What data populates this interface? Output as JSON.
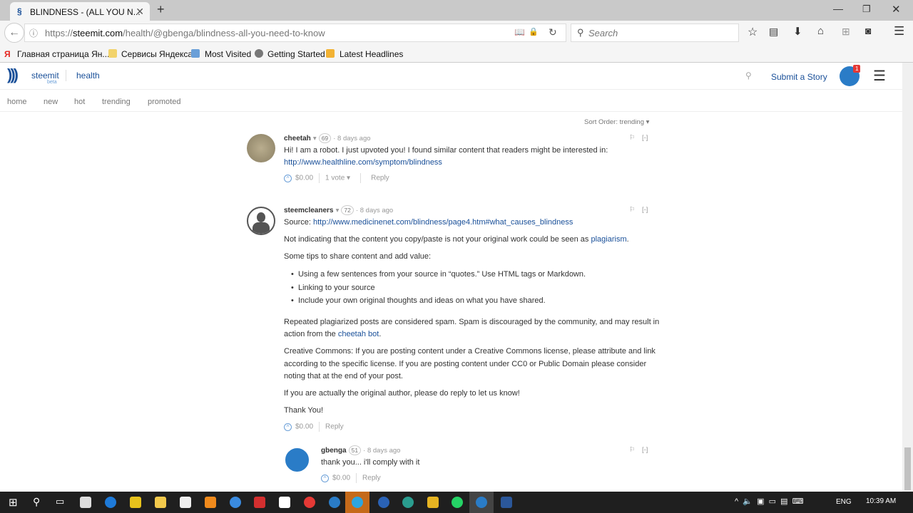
{
  "browser": {
    "tab_title": "BLINDNESS - (ALL YOU N...",
    "url_prefix": "https://",
    "url_domain": "steemit.com",
    "url_path": "/health/@gbenga/blindness-all-you-need-to-know",
    "search_placeholder": "Search",
    "bookmarks": [
      "Главная страница Ян...",
      "Сервисы Яндекса",
      "Most Visited",
      "Getting Started",
      "Latest Headlines"
    ]
  },
  "site": {
    "brand": "steemit",
    "beta": "beta",
    "section": "health",
    "submit": "Submit a Story",
    "notif_count": "1",
    "nav": [
      "home",
      "new",
      "hot",
      "trending",
      "promoted"
    ],
    "sort_label": "Sort Order:",
    "sort_value": "trending"
  },
  "comments": [
    {
      "author": "cheetah",
      "rep": "69",
      "time": "· 8 days ago",
      "text": "Hi! I am a robot. I just upvoted you! I found similar content that readers might be interested in:",
      "link": "http://www.healthline.com/symptom/blindness",
      "payout": "$0.00",
      "votes": "1 vote",
      "reply": "Reply",
      "collapse": "[-]"
    },
    {
      "author": "steemcleaners",
      "rep": "72",
      "time": "· 8 days ago",
      "source_label": "Source: ",
      "source_link": "http://www.medicinenet.com/blindness/page4.htm#what_causes_blindness",
      "p1": "Not indicating that the content you copy/paste is not your original work could be seen as ",
      "p1_link": "plagiarism",
      "p1_end": ".",
      "p2": "Some tips to share content and add value:",
      "bullets": [
        "Using a few sentences from your source in “quotes.” Use HTML tags or Markdown.",
        "Linking to your source",
        "Include your own original thoughts and ideas on what you have shared."
      ],
      "p3a": "Repeated plagiarized posts are considered spam. Spam is discouraged by the community, and may result in",
      "p3b": "action from the ",
      "p3_link": "cheetah bot",
      "p3_end": ".",
      "p4a": "Creative Commons: If you are posting content under a Creative Commons license, please attribute and link",
      "p4b": "according to the specific license. If you are posting content under CC0 or Public Domain please consider",
      "p4c": "noting that at the end of your post.",
      "p5": "If you are actually the original author, please do reply to let us know!",
      "p6": "Thank You!",
      "payout": "$0.00",
      "reply": "Reply",
      "collapse": "[-]"
    },
    {
      "author": "gbenga",
      "rep": "51",
      "time": "· 8 days ago",
      "text": "thank you... i'll comply with it",
      "payout": "$0.00",
      "reply": "Reply",
      "collapse": "[-]"
    }
  ],
  "taskbar": {
    "lang": "ENG",
    "time": "10:39 AM"
  }
}
